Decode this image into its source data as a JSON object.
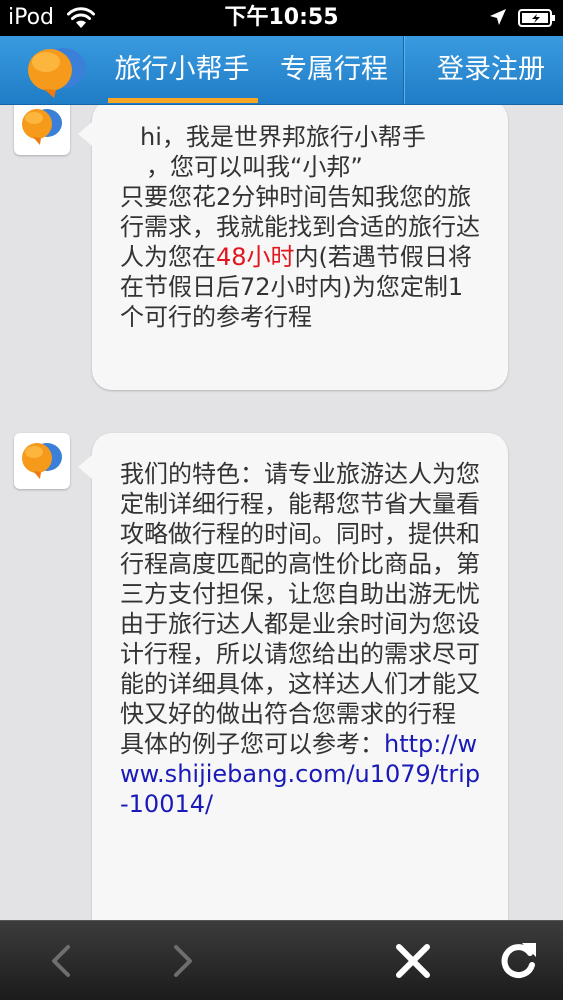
{
  "status_bar": {
    "carrier": "iPod",
    "time": "下午10:55",
    "icons": [
      "wifi-icon",
      "location-icon",
      "battery-icon"
    ]
  },
  "nav": {
    "logo": "app-logo-icon",
    "tabs": [
      {
        "label": "旅行小帮手",
        "active": true
      },
      {
        "label": "专属行程",
        "active": false
      }
    ],
    "login_label": "登录注册",
    "accent_color": "#f6a623",
    "bar_color": "#2b8bd6"
  },
  "messages": [
    {
      "avatar": "app-logo-icon",
      "greeting_line1": " hi，我是世界邦旅行小帮手",
      "greeting_line2": "，您可以叫我“小邦”",
      "body_before": "只要您花2分钟时间告知我您的旅行需求，我就能找到合适的旅行达人为您在",
      "highlight": "48小时",
      "body_after": "内(若遇节假日将在节假日后72小时内)为您定制1个可行的参考行程",
      "highlight_color": "#e0161e"
    },
    {
      "avatar": "app-logo-icon",
      "features": "我们的特色：请专业旅游达人为您定制详细行程，能帮您节省大量看攻略做行程的时间。同时，提供和行程高度匹配的高性价比商品，第三方支付担保，让您自助出游无忧",
      "note": "由于旅行达人都是业余时间为您设计行程，所以请您给出的需求尽可能的详细具体，这样达人们才能又快又好的做出符合您需求的行程",
      "example_prefix": "具体的例子您可以参考：",
      "example_link": "http://www.shijiebang.com/u1079/trip-10014/",
      "link_color": "#1a1ab8"
    }
  ],
  "toolbar": {
    "icons": [
      "back-icon",
      "forward-icon",
      "close-icon",
      "refresh-icon"
    ]
  }
}
